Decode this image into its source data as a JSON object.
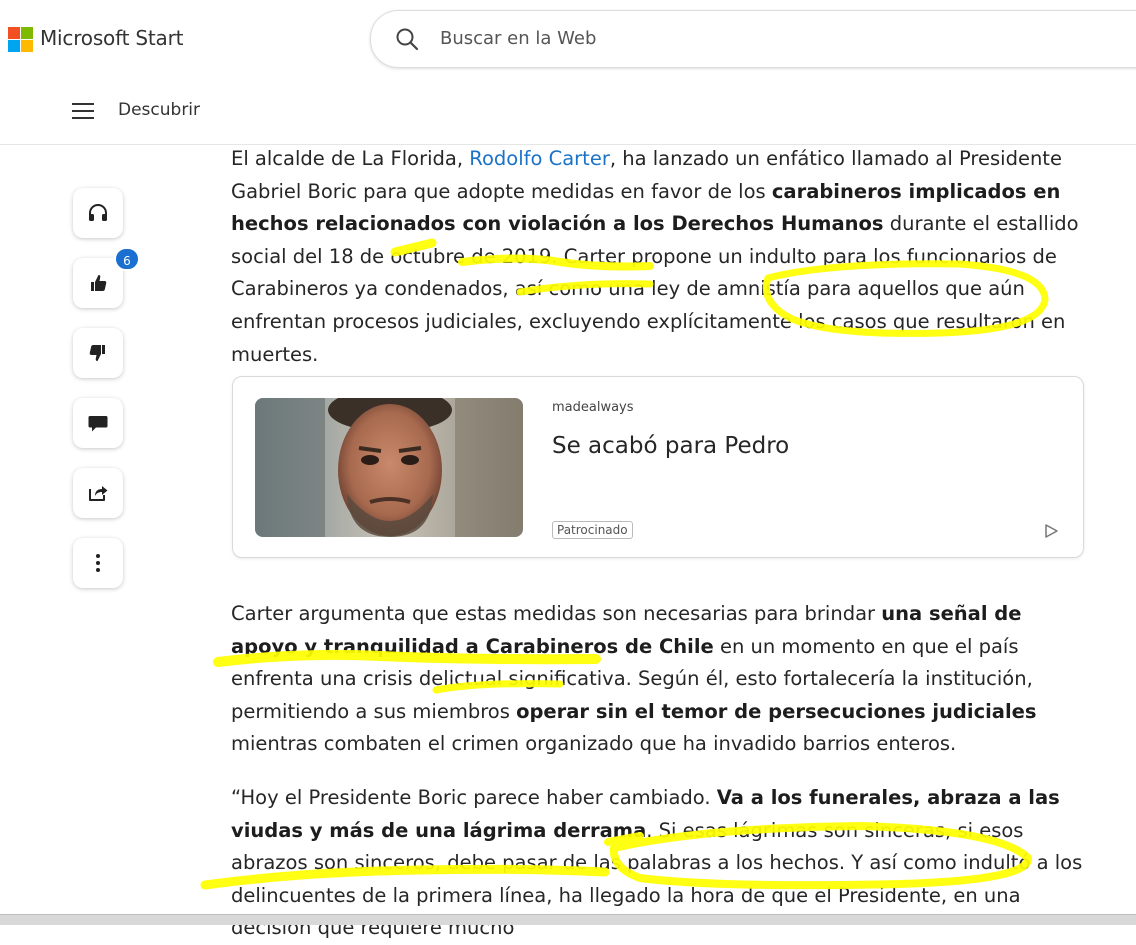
{
  "header": {
    "brand": "Microsoft Start",
    "search_placeholder": "Buscar en la Web",
    "logo_colors": [
      "#f25022",
      "#7fba00",
      "#00a4ef",
      "#ffb900"
    ]
  },
  "nav": {
    "label": "Descubrir"
  },
  "sidebar": {
    "buttons": [
      {
        "name": "listen-button",
        "icon": "headphones-icon"
      },
      {
        "name": "like-button",
        "icon": "thumbs-up-icon"
      },
      {
        "name": "dislike-button",
        "icon": "thumbs-down-icon"
      },
      {
        "name": "comment-button",
        "icon": "comment-icon"
      },
      {
        "name": "share-button",
        "icon": "share-icon"
      },
      {
        "name": "more-button",
        "icon": "more-vertical-icon"
      }
    ],
    "like_count": "6"
  },
  "article": {
    "p1": {
      "t1": "El alcalde de La Florida, ",
      "link": "Rodolfo Carter",
      "t2": ", ha lanzado un enfático llamado al Presidente Gabriel Boric para que adopte medidas en favor de los ",
      "b1": "carabineros implicados en hechos relacionados con violación a los Derechos Humanos",
      "t3": " durante el estallido social del 18 de octubre de 2019. Carter propone un indulto para los funcionarios de Carabineros ya condenados, así como una ley de amnistía para aquellos que aún enfrentan procesos judiciales, excluyendo explícitamente los casos que resultaron en muertes."
    },
    "p2": {
      "t1": "Carter argumenta que estas medidas son necesarias para brindar ",
      "b1": "una señal de apoyo y tranquilidad a Carabineros de Chile",
      "t2": " en un momento en que el país enfrenta una crisis delictual significativa. Según él, esto fortalecería la institución, permitiendo a sus miembros ",
      "b2": "operar sin el temor de persecuciones judiciales",
      "t3": " mientras combaten el crimen organizado que ha invadido barrios enteros."
    },
    "p3": {
      "t1": "“Hoy el Presidente Boric parece haber cambiado. ",
      "b1": "Va a los funerales, abraza a las viudas y más de una lágrima derrama",
      "t2": ". Si esas lágrimas son sinceras, si esos abrazos son sinceros, debe pasar de las palabras a los hechos. Y así como indultó a los delincuentes de la primera línea, ha llegado la hora de que el Presidente, en una decisión que requiere mucho"
    }
  },
  "ad": {
    "source": "madealways",
    "title": "Se acabó para Pedro",
    "tag": "Patrocinado",
    "play_icon": "ad-play-icon"
  },
  "annotation": {
    "color": "#ffff00"
  }
}
